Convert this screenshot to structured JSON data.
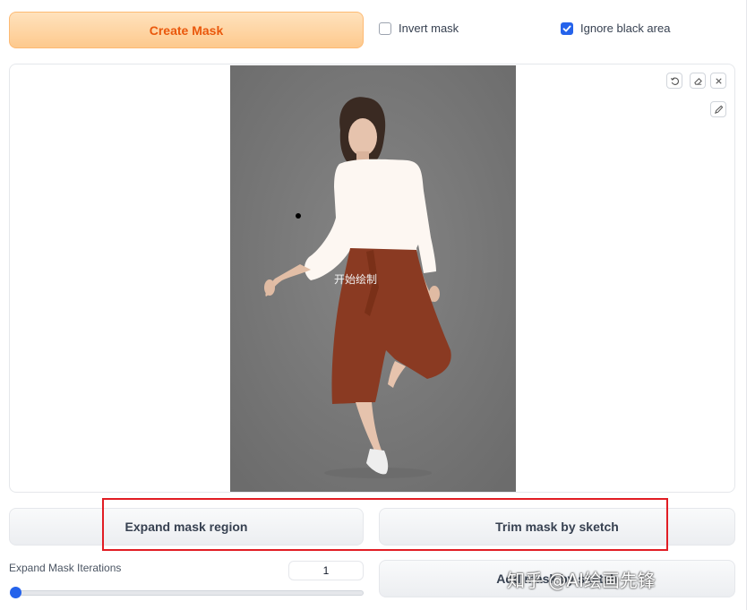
{
  "top": {
    "create_mask_label": "Create Mask",
    "invert_mask_label": "Invert mask",
    "invert_mask_checked": false,
    "ignore_black_label": "Ignore black area",
    "ignore_black_checked": true
  },
  "canvas": {
    "overlay_text": "开始绘制",
    "tools": [
      "undo-icon",
      "eraser-icon",
      "close-icon",
      "brush-icon"
    ]
  },
  "actions": {
    "expand_label": "Expand mask region",
    "trim_label": "Trim mask by sketch",
    "add_label": "Add mask by sketch"
  },
  "iterations": {
    "label": "Expand Mask Iterations",
    "value": "1"
  },
  "watermark": "知乎 @AI绘画先锋",
  "colors": {
    "accent_orange": "#ea580c",
    "checkbox_blue": "#2563eb",
    "highlight_red": "#e11d24"
  }
}
